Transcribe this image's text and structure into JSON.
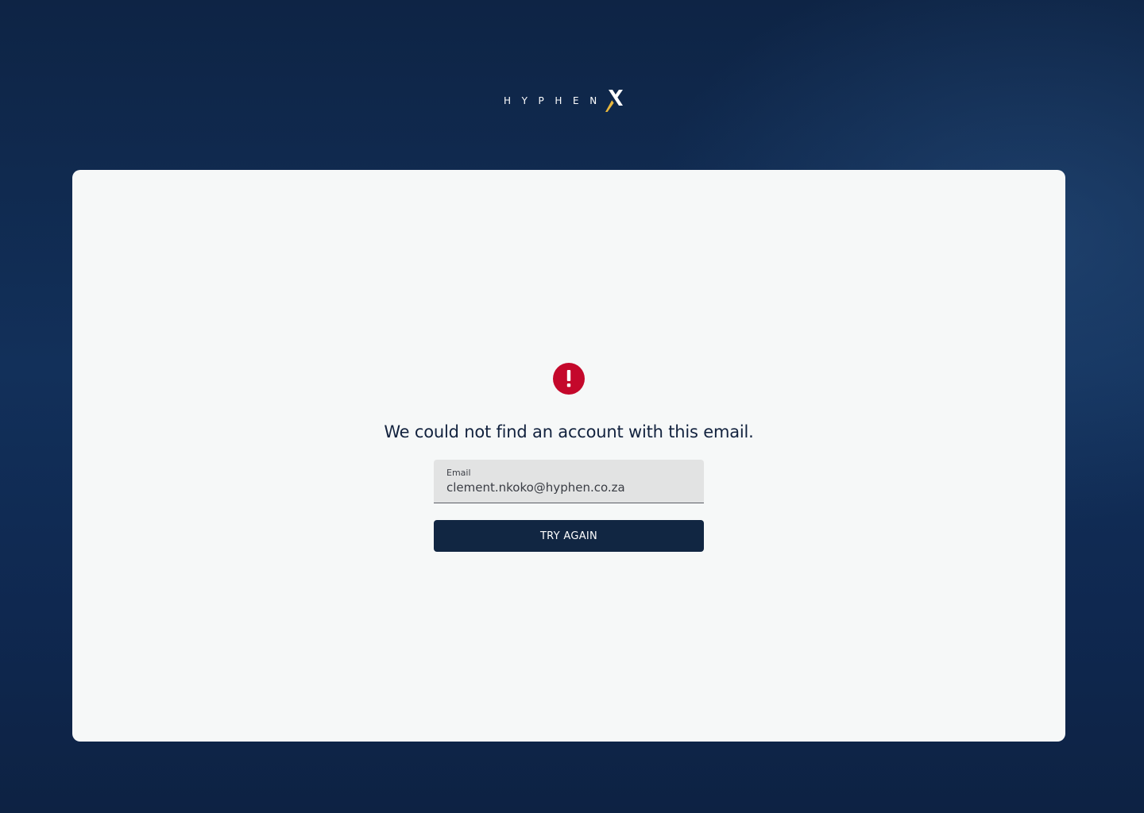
{
  "brand": {
    "logo_text": "HYPHEN",
    "logo_mark": "X",
    "accent_color": "#e8b73c",
    "logo_color": "#ffffff"
  },
  "colors": {
    "background": "#0f2648",
    "card": "#f6f8f8",
    "error": "#c4082b",
    "primary_button": "#112642",
    "text_dark": "#12223e"
  },
  "error": {
    "icon": "alert-circle-icon",
    "message": "We could not find an account with this email."
  },
  "email_field": {
    "label": "Email",
    "value": "clement.nkoko@hyphen.co.za"
  },
  "actions": {
    "try_again_label": "TRY AGAIN"
  }
}
